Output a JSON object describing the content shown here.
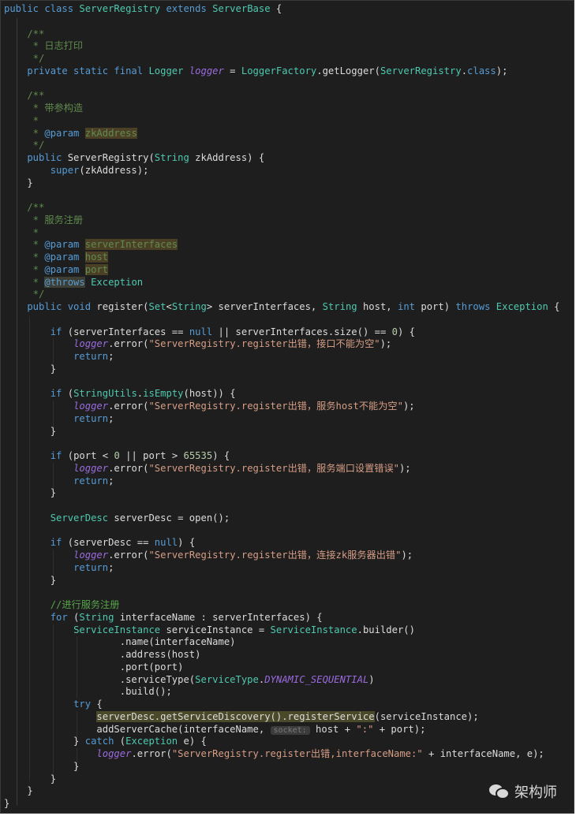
{
  "editor": {
    "language": "Java",
    "lines": [
      [
        {
          "t": "public class ",
          "c": "kw"
        },
        {
          "t": "ServerRegistry",
          "c": "ty"
        },
        {
          "t": " extends ",
          "c": "kw"
        },
        {
          "t": "ServerBase",
          "c": "ty"
        },
        {
          "t": " {",
          "c": ""
        }
      ],
      [],
      [
        {
          "t": "    /**",
          "c": "doc"
        }
      ],
      [
        {
          "t": "     * 日志打印",
          "c": "doc"
        }
      ],
      [
        {
          "t": "     */",
          "c": "doc"
        }
      ],
      [
        {
          "t": "    private static final ",
          "c": "kw"
        },
        {
          "t": "Logger",
          "c": "ty"
        },
        {
          "t": " ",
          "c": ""
        },
        {
          "t": "logger",
          "c": "fld"
        },
        {
          "t": " = ",
          "c": ""
        },
        {
          "t": "LoggerFactory",
          "c": "ty"
        },
        {
          "t": ".getLogger(",
          "c": ""
        },
        {
          "t": "ServerRegistry",
          "c": "ty"
        },
        {
          "t": ".",
          "c": ""
        },
        {
          "t": "class",
          "c": "kw"
        },
        {
          "t": ");",
          "c": ""
        }
      ],
      [],
      [
        {
          "t": "    /**",
          "c": "doc"
        }
      ],
      [
        {
          "t": "     * 带参构造",
          "c": "doc"
        }
      ],
      [
        {
          "t": "     *",
          "c": "doc"
        }
      ],
      [
        {
          "t": "     * ",
          "c": "doc"
        },
        {
          "t": "@param",
          "c": "tag"
        },
        {
          "t": " ",
          "c": "doc"
        },
        {
          "t": "zkAddress",
          "c": "doc hl"
        }
      ],
      [
        {
          "t": "     */",
          "c": "doc"
        }
      ],
      [
        {
          "t": "    public ",
          "c": "kw"
        },
        {
          "t": "ServerRegistry(",
          "c": ""
        },
        {
          "t": "String",
          "c": "ty"
        },
        {
          "t": " zkAddress) {",
          "c": ""
        }
      ],
      [
        {
          "t": "        ",
          "c": ""
        },
        {
          "t": "super",
          "c": "kw"
        },
        {
          "t": "(zkAddress);",
          "c": ""
        }
      ],
      [
        {
          "t": "    }",
          "c": ""
        }
      ],
      [],
      [
        {
          "t": "    /**",
          "c": "doc"
        }
      ],
      [
        {
          "t": "     * 服务注册",
          "c": "doc"
        }
      ],
      [
        {
          "t": "     *",
          "c": "doc"
        }
      ],
      [
        {
          "t": "     * ",
          "c": "doc"
        },
        {
          "t": "@param",
          "c": "tag"
        },
        {
          "t": " ",
          "c": "doc"
        },
        {
          "t": "serverInterfaces",
          "c": "doc hl"
        }
      ],
      [
        {
          "t": "     * ",
          "c": "doc"
        },
        {
          "t": "@param",
          "c": "tag"
        },
        {
          "t": " ",
          "c": "doc"
        },
        {
          "t": "host",
          "c": "doc hl"
        }
      ],
      [
        {
          "t": "     * ",
          "c": "doc"
        },
        {
          "t": "@param",
          "c": "tag"
        },
        {
          "t": " ",
          "c": "doc"
        },
        {
          "t": "port",
          "c": "doc hl"
        }
      ],
      [
        {
          "t": "     * ",
          "c": "doc"
        },
        {
          "t": "@throws",
          "c": "tag hl2"
        },
        {
          "t": " Exception",
          "c": "ty"
        }
      ],
      [
        {
          "t": "     */",
          "c": "doc"
        }
      ],
      [
        {
          "t": "    public void ",
          "c": "kw"
        },
        {
          "t": "register(",
          "c": ""
        },
        {
          "t": "Set",
          "c": "ty"
        },
        {
          "t": "<",
          "c": ""
        },
        {
          "t": "String",
          "c": "ty"
        },
        {
          "t": "> serverInterfaces, ",
          "c": ""
        },
        {
          "t": "String",
          "c": "ty"
        },
        {
          "t": " host, ",
          "c": ""
        },
        {
          "t": "int",
          "c": "kw"
        },
        {
          "t": " port) ",
          "c": ""
        },
        {
          "t": "throws ",
          "c": "kw"
        },
        {
          "t": "Exception",
          "c": "ty"
        },
        {
          "t": " {",
          "c": ""
        }
      ],
      [],
      [
        {
          "t": "        ",
          "c": ""
        },
        {
          "t": "if",
          "c": "kw"
        },
        {
          "t": " (serverInterfaces == ",
          "c": ""
        },
        {
          "t": "null",
          "c": "kw"
        },
        {
          "t": " || serverInterfaces.size() == ",
          "c": ""
        },
        {
          "t": "0",
          "c": "num"
        },
        {
          "t": ") {",
          "c": ""
        }
      ],
      [
        {
          "t": "            ",
          "c": ""
        },
        {
          "t": "logger",
          "c": "fld"
        },
        {
          "t": ".error(",
          "c": ""
        },
        {
          "t": "\"ServerRegistry.register出错，接口不能为空\"",
          "c": "str"
        },
        {
          "t": ");",
          "c": ""
        }
      ],
      [
        {
          "t": "            ",
          "c": ""
        },
        {
          "t": "return",
          "c": "kw"
        },
        {
          "t": ";",
          "c": ""
        }
      ],
      [
        {
          "t": "        }",
          "c": ""
        }
      ],
      [],
      [
        {
          "t": "        ",
          "c": ""
        },
        {
          "t": "if",
          "c": "kw"
        },
        {
          "t": " (",
          "c": ""
        },
        {
          "t": "StringUtils",
          "c": "ty"
        },
        {
          "t": ".",
          "c": ""
        },
        {
          "t": "isEmpty",
          "c": "ty"
        },
        {
          "t": "(host)) {",
          "c": ""
        }
      ],
      [
        {
          "t": "            ",
          "c": ""
        },
        {
          "t": "logger",
          "c": "fld"
        },
        {
          "t": ".error(",
          "c": ""
        },
        {
          "t": "\"ServerRegistry.register出错，服务host不能为空\"",
          "c": "str"
        },
        {
          "t": ");",
          "c": ""
        }
      ],
      [
        {
          "t": "            ",
          "c": ""
        },
        {
          "t": "return",
          "c": "kw"
        },
        {
          "t": ";",
          "c": ""
        }
      ],
      [
        {
          "t": "        }",
          "c": ""
        }
      ],
      [],
      [
        {
          "t": "        ",
          "c": ""
        },
        {
          "t": "if",
          "c": "kw"
        },
        {
          "t": " (port < ",
          "c": ""
        },
        {
          "t": "0",
          "c": "num"
        },
        {
          "t": " || port > ",
          "c": ""
        },
        {
          "t": "65535",
          "c": "num"
        },
        {
          "t": ") {",
          "c": ""
        }
      ],
      [
        {
          "t": "            ",
          "c": ""
        },
        {
          "t": "logger",
          "c": "fld"
        },
        {
          "t": ".error(",
          "c": ""
        },
        {
          "t": "\"ServerRegistry.register出错，服务端口设置错误\"",
          "c": "str"
        },
        {
          "t": ");",
          "c": ""
        }
      ],
      [
        {
          "t": "            ",
          "c": ""
        },
        {
          "t": "return",
          "c": "kw"
        },
        {
          "t": ";",
          "c": ""
        }
      ],
      [
        {
          "t": "        }",
          "c": ""
        }
      ],
      [],
      [
        {
          "t": "        ",
          "c": ""
        },
        {
          "t": "ServerDesc",
          "c": "ty"
        },
        {
          "t": " serverDesc = open();",
          "c": ""
        }
      ],
      [],
      [
        {
          "t": "        ",
          "c": ""
        },
        {
          "t": "if",
          "c": "kw"
        },
        {
          "t": " (serverDesc == ",
          "c": ""
        },
        {
          "t": "null",
          "c": "kw"
        },
        {
          "t": ") {",
          "c": ""
        }
      ],
      [
        {
          "t": "            ",
          "c": ""
        },
        {
          "t": "logger",
          "c": "fld"
        },
        {
          "t": ".error(",
          "c": ""
        },
        {
          "t": "\"ServerRegistry.register出错，连接zk服务器出错\"",
          "c": "str"
        },
        {
          "t": ");",
          "c": ""
        }
      ],
      [
        {
          "t": "            ",
          "c": ""
        },
        {
          "t": "return",
          "c": "kw"
        },
        {
          "t": ";",
          "c": ""
        }
      ],
      [
        {
          "t": "        }",
          "c": ""
        }
      ],
      [],
      [
        {
          "t": "        //进行服务注册",
          "c": "cm"
        }
      ],
      [
        {
          "t": "        ",
          "c": ""
        },
        {
          "t": "for",
          "c": "kw"
        },
        {
          "t": " (",
          "c": ""
        },
        {
          "t": "String",
          "c": "ty"
        },
        {
          "t": " interfaceName : serverInterfaces) {",
          "c": ""
        }
      ],
      [
        {
          "t": "            ",
          "c": ""
        },
        {
          "t": "ServiceInstance",
          "c": "ty"
        },
        {
          "t": " serviceInstance = ",
          "c": ""
        },
        {
          "t": "ServiceInstance",
          "c": "ty"
        },
        {
          "t": ".builder()",
          "c": ""
        }
      ],
      [
        {
          "t": "                    .name(interfaceName)",
          "c": ""
        }
      ],
      [
        {
          "t": "                    .address(host)",
          "c": ""
        }
      ],
      [
        {
          "t": "                    .port(port)",
          "c": ""
        }
      ],
      [
        {
          "t": "                    .serviceType(",
          "c": ""
        },
        {
          "t": "ServiceType",
          "c": "ty"
        },
        {
          "t": ".",
          "c": ""
        },
        {
          "t": "DYNAMIC_SEQUENTIAL",
          "c": "fld"
        },
        {
          "t": ")",
          "c": ""
        }
      ],
      [
        {
          "t": "                    .build();",
          "c": ""
        }
      ],
      [
        {
          "t": "            ",
          "c": ""
        },
        {
          "t": "try",
          "c": "kw"
        },
        {
          "t": " {",
          "c": ""
        }
      ],
      [
        {
          "t": "                ",
          "c": ""
        },
        {
          "t": "serverDesc.getServiceDiscovery().registerService",
          "c": "hl3"
        },
        {
          "t": "(serviceInstance);",
          "c": ""
        }
      ],
      [
        {
          "t": "                addServerCache(interfaceName, ",
          "c": ""
        },
        {
          "t": "socket:",
          "c": "pill"
        },
        {
          "t": " host + ",
          "c": ""
        },
        {
          "t": "\":\"",
          "c": "str"
        },
        {
          "t": " + port);",
          "c": ""
        }
      ],
      [
        {
          "t": "            } ",
          "c": ""
        },
        {
          "t": "catch",
          "c": "kw"
        },
        {
          "t": " (",
          "c": ""
        },
        {
          "t": "Exception",
          "c": "ty"
        },
        {
          "t": " e) {",
          "c": ""
        }
      ],
      [
        {
          "t": "                ",
          "c": ""
        },
        {
          "t": "logger",
          "c": "fld"
        },
        {
          "t": ".error(",
          "c": ""
        },
        {
          "t": "\"ServerRegistry.register出错,interfaceName:\"",
          "c": "str"
        },
        {
          "t": " + interfaceName, e);",
          "c": ""
        }
      ],
      [
        {
          "t": "            }",
          "c": ""
        }
      ],
      [
        {
          "t": "        }",
          "c": ""
        }
      ],
      [
        {
          "t": "    }",
          "c": ""
        }
      ],
      [
        {
          "t": "}",
          "c": ""
        }
      ]
    ]
  },
  "watermark": {
    "icon": "wechat-icon",
    "text": "架构师"
  }
}
